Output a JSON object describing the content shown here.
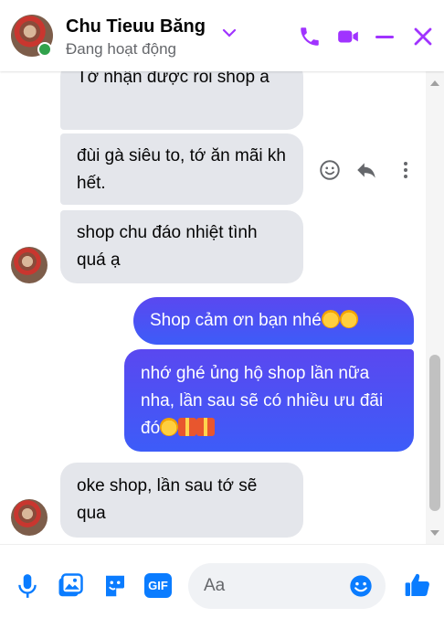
{
  "header": {
    "contact_name": "Chu Tieuu Băng",
    "status": "Đang hoạt động",
    "icons": [
      "chevron-down-icon",
      "phone-icon",
      "video-call-icon",
      "minimize-icon",
      "close-icon"
    ],
    "accent_color": "#a033ff"
  },
  "messages": [
    {
      "side": "incoming",
      "text": "Tớ nhận được roi shop a"
    },
    {
      "side": "incoming",
      "text": "đùi gà siêu to, tớ ăn mãi kh hết."
    },
    {
      "side": "incoming",
      "text": "shop chu đáo nhiệt tình quá ạ"
    },
    {
      "side": "outgoing",
      "text": "Shop cảm ơn bạn nhé"
    },
    {
      "side": "outgoing",
      "text": "nhớ ghé ủng hộ shop lần nữa nha, lần sau sẽ có nhiều ưu đãi đó"
    },
    {
      "side": "incoming",
      "text": "oke shop, lần sau tớ sẽ qua"
    }
  ],
  "message_actions": [
    "react-icon",
    "reply-icon",
    "more-icon"
  ],
  "composer": {
    "placeholder": "Aa",
    "gif_label": "GIF",
    "icons": [
      "microphone-icon",
      "image-icon",
      "sticker-icon",
      "gif-icon",
      "emoji-icon",
      "like-icon"
    ]
  },
  "colors": {
    "outgoing_bubble": "#4d4dfb",
    "incoming_bubble": "#e4e6eb",
    "icon_blue": "#0a7cff"
  }
}
